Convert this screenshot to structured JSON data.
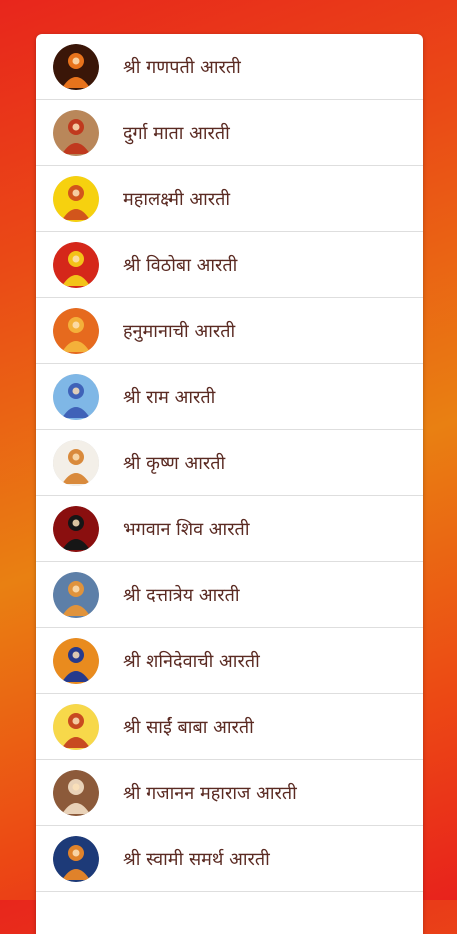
{
  "aarti_list": [
    {
      "label": "श्री गणपती आरती",
      "icon": "ganpati-icon",
      "bg": "#3a1608",
      "accent": "#e8731c"
    },
    {
      "label": "दुर्गा माता आरती",
      "icon": "durga-icon",
      "bg": "#b9875a",
      "accent": "#c0391e"
    },
    {
      "label": "महालक्ष्मी आरती",
      "icon": "lakshmi-icon",
      "bg": "#f6d10f",
      "accent": "#d2551c"
    },
    {
      "label": "श्री विठोबा आरती",
      "icon": "vithoba-icon",
      "bg": "#d5271a",
      "accent": "#f3c318"
    },
    {
      "label": "हनुमानाची आरती",
      "icon": "hanuman-icon",
      "bg": "#e66a1e",
      "accent": "#f4b13a"
    },
    {
      "label": "श्री राम आरती",
      "icon": "ram-icon",
      "bg": "#7fb7e6",
      "accent": "#3f62b8"
    },
    {
      "label": "श्री कृष्ण आरती",
      "icon": "krishna-icon",
      "bg": "#f3efe8",
      "accent": "#d98a3c"
    },
    {
      "label": "भगवान शिव आरती",
      "icon": "shiva-icon",
      "bg": "#8a0f0f",
      "accent": "#161616"
    },
    {
      "label": "श्री दत्तात्रेय आरती",
      "icon": "dattatreya-icon",
      "bg": "#5d7fa8",
      "accent": "#e0933c"
    },
    {
      "label": "श्री शनिदेवाची आरती",
      "icon": "shanidev-icon",
      "bg": "#e98b1e",
      "accent": "#263a8c"
    },
    {
      "label": "श्री साईं बाबा आरती",
      "icon": "saibaba-icon",
      "bg": "#f7d84a",
      "accent": "#c84a20"
    },
    {
      "label": "श्री गजानन महाराज आरती",
      "icon": "gajanan-icon",
      "bg": "#8c5a3a",
      "accent": "#e9d2b8"
    },
    {
      "label": "श्री स्वामी समर्थ आरती",
      "icon": "swami-samarth-icon",
      "bg": "#1d3a78",
      "accent": "#e0822a"
    }
  ]
}
